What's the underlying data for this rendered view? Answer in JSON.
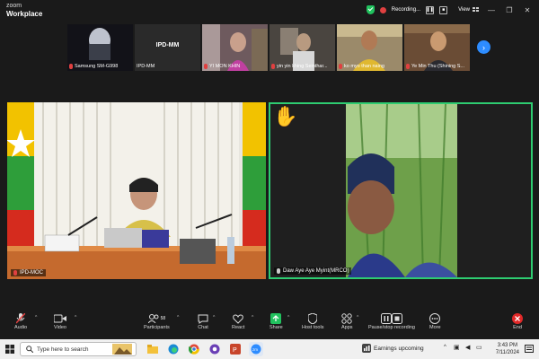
{
  "window": {
    "brand_small": "zoom",
    "brand_large": "Workplace",
    "recording_label": "Recording...",
    "view_label": "View"
  },
  "participants": [
    {
      "name": "Samsung SM-G998",
      "muted": true
    },
    {
      "name": "IPD-MM",
      "muted": false,
      "center_text": "IPD-MM"
    },
    {
      "name": "YI MON KHIN",
      "muted": true
    },
    {
      "name": "yin yin khing Seinthar...",
      "muted": true
    },
    {
      "name": "ko myo than naing",
      "muted": true
    },
    {
      "name": "Ye Min Thu (Shining S...",
      "muted": true
    }
  ],
  "main_tiles": {
    "left_name": "IPD-MOC",
    "right_name": "Daw Aye Aye Myint(MRCO)",
    "right_hand_icon": "raised-hand-icon"
  },
  "toolbar": {
    "audio": "Audio",
    "video": "Video",
    "participants": "Participants",
    "participants_count": "58",
    "chat": "Chat",
    "react": "React",
    "share": "Share",
    "host_tools": "Host tools",
    "apps": "Apps",
    "pause_stop": "Pause/stop recording",
    "more": "More",
    "end": "End"
  },
  "taskbar": {
    "search_placeholder": "Type here to search",
    "news": "Earnings upcoming",
    "time": "3:43 PM",
    "date": "7/11/2024"
  },
  "colors": {
    "accent": "#2d8cff",
    "active_speaker": "#2ecc71",
    "record": "#e04040",
    "share": "#21c25e",
    "end": "#e02828"
  }
}
